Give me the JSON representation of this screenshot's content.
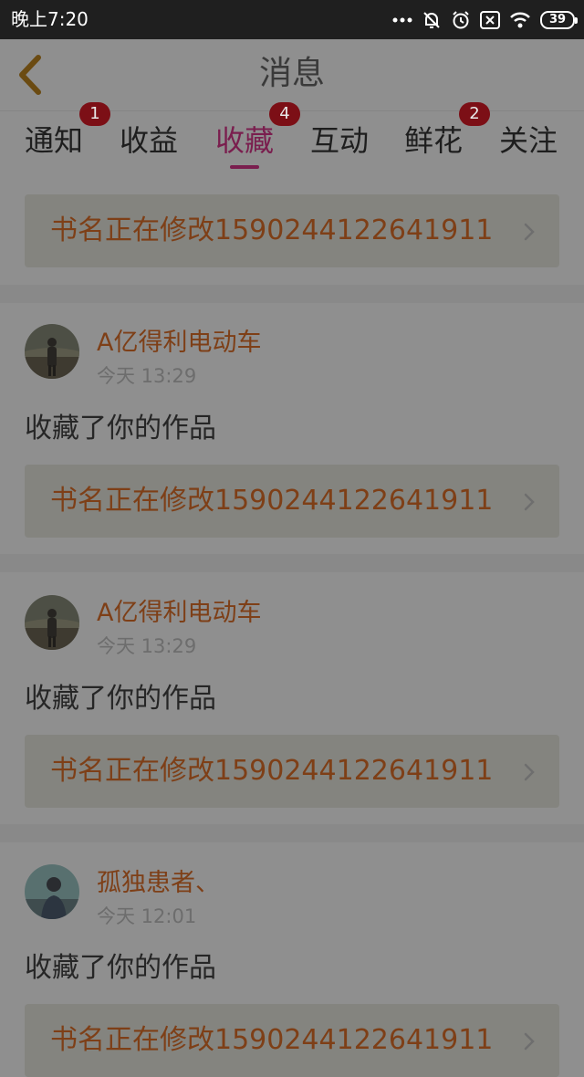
{
  "status_bar": {
    "time": "晚上7:20",
    "battery": "39",
    "icons": [
      "more-dots-icon",
      "bell-off-icon",
      "alarm-icon",
      "sim-x-icon",
      "wifi-icon",
      "battery-icon"
    ]
  },
  "header": {
    "title": "消息",
    "back_icon": "chevron-left-icon"
  },
  "tabs": [
    {
      "label": "通知",
      "badge": "1"
    },
    {
      "label": "收益",
      "badge": ""
    },
    {
      "label": "收藏",
      "badge": "4",
      "active": true
    },
    {
      "label": "互动",
      "badge": ""
    },
    {
      "label": "鲜花",
      "badge": "2"
    },
    {
      "label": "关注",
      "badge": ""
    }
  ],
  "first_book_card": {
    "title": "书名正在修改1590244122641911"
  },
  "notifications": [
    {
      "username": "A亿得利电动车",
      "time": "今天 13:29",
      "message": "收藏了你的作品",
      "book_title": "书名正在修改1590244122641911"
    },
    {
      "username": "A亿得利电动车",
      "time": "今天 13:29",
      "message": "收藏了你的作品",
      "book_title": "书名正在修改1590244122641911"
    },
    {
      "username": "孤独患者、",
      "time": "今天 12:01",
      "message": "收藏了你的作品",
      "book_title": "书名正在修改1590244122641911"
    }
  ],
  "colors": {
    "overlay_bg": "#8f8f8f",
    "accent": "#7a1e4e",
    "badge": "#7c0f16",
    "book_title": "#7e3f17"
  }
}
